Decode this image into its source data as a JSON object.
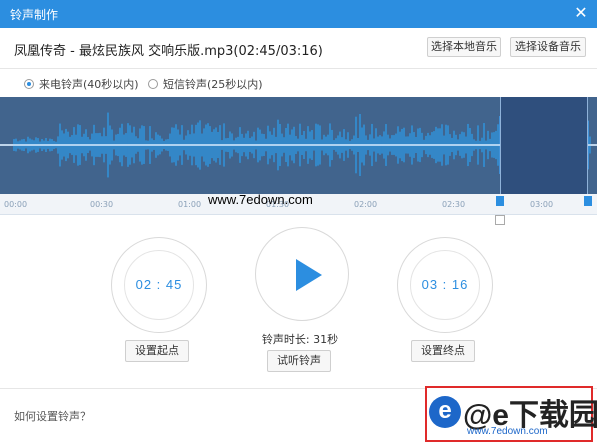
{
  "window": {
    "title": "铃声制作"
  },
  "file": {
    "name": "凤凰传奇 - 最炫民族风 交响乐版.mp3(02:45/03:16)"
  },
  "header": {
    "btn_local": "选择本地音乐",
    "btn_device": "选择设备音乐"
  },
  "options": [
    {
      "label": "来电铃声(40秒以内)",
      "selected": true
    },
    {
      "label": "短信铃声(25秒以内)",
      "selected": false
    }
  ],
  "ruler": {
    "ticks": [
      "00:00",
      "00:30",
      "01:00",
      "01:30",
      "02:00",
      "02:30",
      "03:00"
    ]
  },
  "controls": {
    "start_time": "02 : 45",
    "end_time": "03 : 16",
    "set_start": "设置起点",
    "set_end": "设置终点",
    "duration": "铃声时长: 31秒",
    "preview": "试听铃声"
  },
  "footer": {
    "help": "如何设置铃声？"
  },
  "watermarks": {
    "center": "www.7edown.com",
    "logo_big": "@e下载园",
    "logo_small": "www.7edown.com"
  },
  "colors": {
    "accent": "#2c8ee0",
    "wave_bg": "#41648d"
  }
}
